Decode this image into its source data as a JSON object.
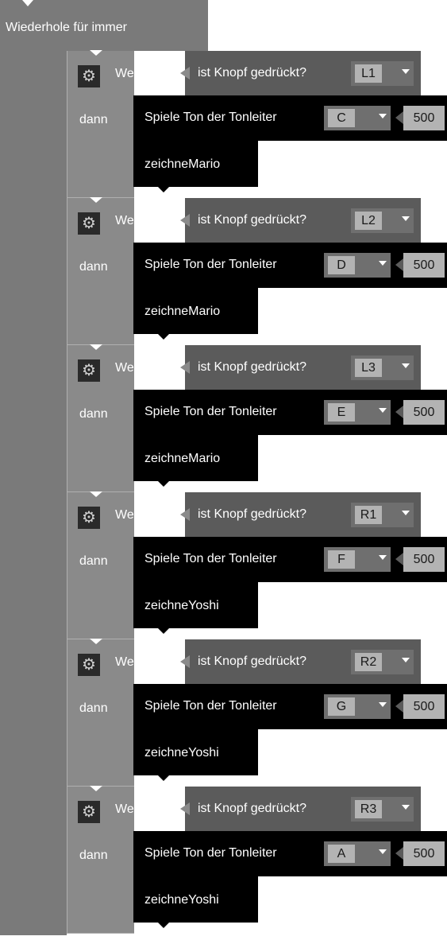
{
  "loop": {
    "label": "Wiederhole für immer"
  },
  "blocks": [
    {
      "wenn": "Wenn",
      "dann": "dann",
      "condition": "ist Knopf gedrückt?",
      "button": "L1",
      "play": "Spiele Ton der Tonleiter",
      "note": "C",
      "duration": "500",
      "draw": "zeichneMario"
    },
    {
      "wenn": "Wenn",
      "dann": "dann",
      "condition": "ist Knopf gedrückt?",
      "button": "L2",
      "play": "Spiele Ton der Tonleiter",
      "note": "D",
      "duration": "500",
      "draw": "zeichneMario"
    },
    {
      "wenn": "Wenn",
      "dann": "dann",
      "condition": "ist Knopf gedrückt?",
      "button": "L3",
      "play": "Spiele Ton der Tonleiter",
      "note": "E",
      "duration": "500",
      "draw": "zeichneMario"
    },
    {
      "wenn": "Wenn",
      "dann": "dann",
      "condition": "ist Knopf gedrückt?",
      "button": "R1",
      "play": "Spiele Ton der Tonleiter",
      "note": "F",
      "duration": "500",
      "draw": "zeichneYoshi"
    },
    {
      "wenn": "Wenn",
      "dann": "dann",
      "condition": "ist Knopf gedrückt?",
      "button": "R2",
      "play": "Spiele Ton der Tonleiter",
      "note": "G",
      "duration": "500",
      "draw": "zeichneYoshi"
    },
    {
      "wenn": "Wenn",
      "dann": "dann",
      "condition": "ist Knopf gedrückt?",
      "button": "R3",
      "play": "Spiele Ton der Tonleiter",
      "note": "A",
      "duration": "500",
      "draw": "zeichneYoshi"
    }
  ],
  "icons": {
    "settings": "gear-icon",
    "dropdown": "chevron-down-icon"
  },
  "colors": {
    "loop": "#7a7a7a",
    "if_block": "#8a8a8a",
    "condition": "#5b5b5b",
    "statement": "#000000",
    "field": "#b3b3b3"
  }
}
